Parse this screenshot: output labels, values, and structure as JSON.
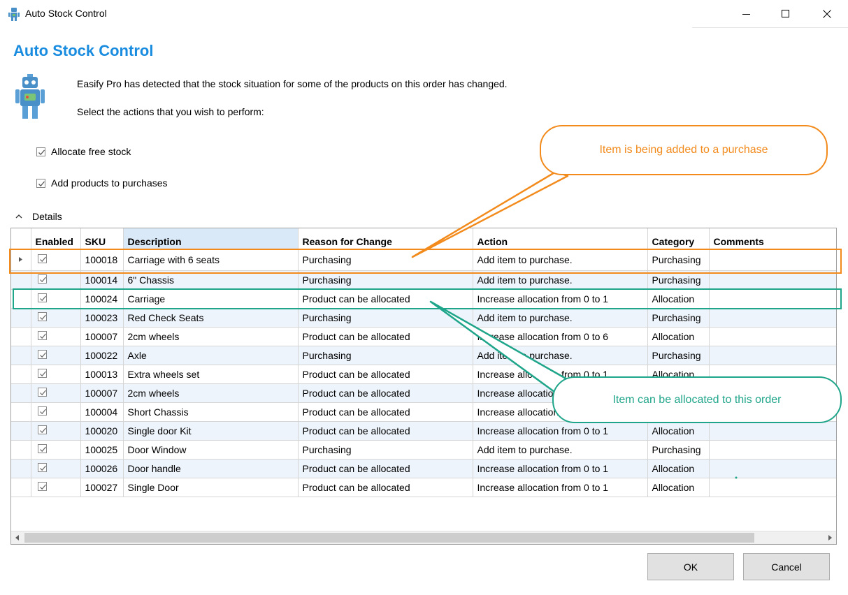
{
  "window": {
    "title": "Auto Stock Control"
  },
  "heading": "Auto Stock Control",
  "messages": {
    "detected": "Easify Pro has detected that the stock situation for some of the products on this order has changed.",
    "select": "Select the actions that you wish to perform:"
  },
  "options": {
    "allocate": {
      "label": "Allocate free stock",
      "checked": true
    },
    "purchases": {
      "label": "Add products to purchases",
      "checked": true
    }
  },
  "details_label": "Details",
  "table": {
    "columns": [
      "Enabled",
      "SKU",
      "Description",
      "Reason for Change",
      "Action",
      "Category",
      "Comments"
    ],
    "rows": [
      {
        "enabled": true,
        "sku": "100018",
        "description": "Carriage with 6 seats",
        "reason": "Purchasing",
        "action": "Add item to purchase.",
        "category": "Purchasing",
        "comments": ""
      },
      {
        "enabled": true,
        "sku": "100014",
        "description": "6\" Chassis",
        "reason": "Purchasing",
        "action": "Add item to purchase.",
        "category": "Purchasing",
        "comments": ""
      },
      {
        "enabled": true,
        "sku": "100024",
        "description": "Carriage",
        "reason": "Product can be allocated",
        "action": "Increase allocation from 0 to 1",
        "category": "Allocation",
        "comments": ""
      },
      {
        "enabled": true,
        "sku": "100023",
        "description": "Red Check Seats",
        "reason": "Purchasing",
        "action": "Add item to purchase.",
        "category": "Purchasing",
        "comments": ""
      },
      {
        "enabled": true,
        "sku": "100007",
        "description": "2cm wheels",
        "reason": "Product can be allocated",
        "action": "Increase allocation from 0 to 6",
        "category": "Allocation",
        "comments": ""
      },
      {
        "enabled": true,
        "sku": "100022",
        "description": "Axle",
        "reason": "Purchasing",
        "action": "Add item to purchase.",
        "category": "Purchasing",
        "comments": ""
      },
      {
        "enabled": true,
        "sku": "100013",
        "description": "Extra wheels set",
        "reason": "Product can be allocated",
        "action": "Increase allocation from 0 to 1",
        "category": "Allocation",
        "comments": ""
      },
      {
        "enabled": true,
        "sku": "100007",
        "description": "2cm wheels",
        "reason": "Product can be allocated",
        "action": "Increase allocation from 0 to 1",
        "category": "Allocation",
        "comments": ""
      },
      {
        "enabled": true,
        "sku": "100004",
        "description": "Short Chassis",
        "reason": "Product can be allocated",
        "action": "Increase allocation from 0 to 1",
        "category": "Allocation",
        "comments": ""
      },
      {
        "enabled": true,
        "sku": "100020",
        "description": "Single door Kit",
        "reason": "Product can be allocated",
        "action": "Increase allocation from 0 to 1",
        "category": "Allocation",
        "comments": ""
      },
      {
        "enabled": true,
        "sku": "100025",
        "description": "Door Window",
        "reason": "Purchasing",
        "action": "Add item to purchase.",
        "category": "Purchasing",
        "comments": ""
      },
      {
        "enabled": true,
        "sku": "100026",
        "description": "Door handle",
        "reason": "Product can be allocated",
        "action": "Increase allocation from 0 to 1",
        "category": "Allocation",
        "comments": ""
      },
      {
        "enabled": true,
        "sku": "100027",
        "description": "Single Door",
        "reason": "Product can be allocated",
        "action": "Increase allocation from 0 to 1",
        "category": "Allocation",
        "comments": ""
      }
    ]
  },
  "buttons": {
    "ok": "OK",
    "cancel": "Cancel"
  },
  "annotations": {
    "purchase_callout": "Item is being added to a purchase",
    "allocation_callout": "Item can be allocated to this order",
    "purchase_color": "#f28a1c",
    "allocation_color": "#1fa58a"
  },
  "colors": {
    "heading": "#1a8ce0",
    "selected_header": "#d9e9f8",
    "alt_row": "#eef4fb"
  }
}
